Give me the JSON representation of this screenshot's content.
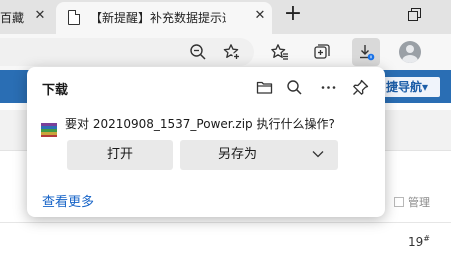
{
  "tabs": {
    "previous": {
      "label": "百藏",
      "close_glyph": "✕"
    },
    "active": {
      "title": "【新提醒】补充数据提示通讯",
      "close_glyph": "✕"
    },
    "new_tab_glyph": "+"
  },
  "toolbar": {
    "icons": [
      "zoom-out-icon",
      "add-favorite-icon",
      "favorites-icon",
      "collections-icon",
      "download-icon",
      "profile-avatar"
    ]
  },
  "page": {
    "nav_button": "捷导航▾",
    "manage_label": "管理",
    "floor_number": "19",
    "floor_suffix": "#"
  },
  "downloads": {
    "title": "下载",
    "question": "要对 20210908_1537_Power.zip 执行什么操作?",
    "open_label": "打开",
    "save_as_label": "另存为",
    "see_more_label": "查看更多"
  },
  "colors": {
    "accent_blue": "#2a6eb4",
    "link_blue": "#1663c7",
    "badge_blue": "#1a73e8"
  }
}
